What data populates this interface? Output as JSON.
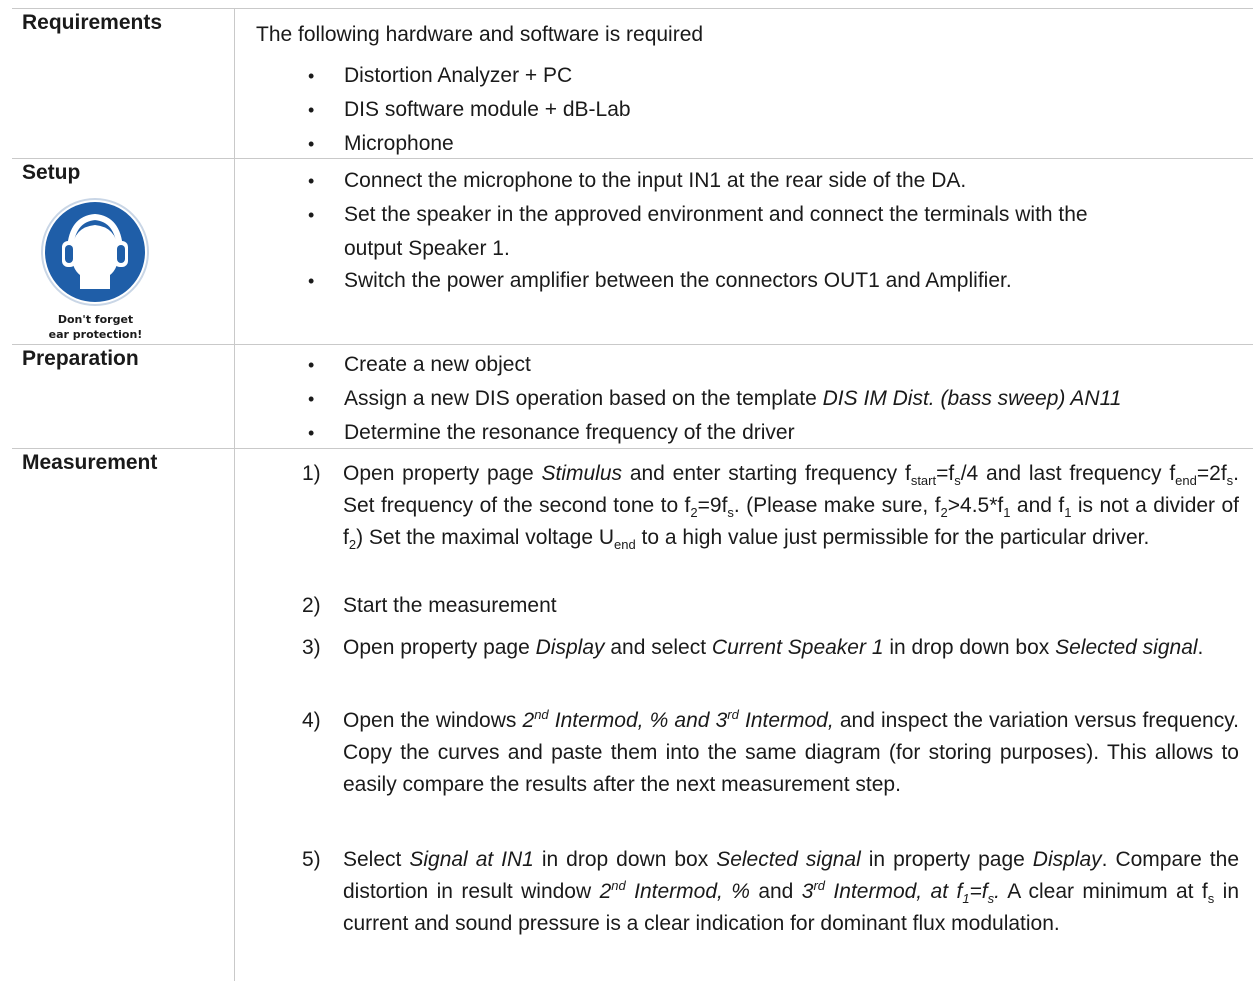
{
  "requirements": {
    "label": "Requirements",
    "intro": "The following hardware and software is required",
    "items": [
      "Distortion Analyzer + PC",
      "DIS software module + dB-Lab",
      "Microphone"
    ]
  },
  "setup": {
    "label": "Setup",
    "sign_caption_line1": "Don't forget",
    "sign_caption_line2": "ear protection!",
    "items": [
      "Connect the microphone to the input IN1 at the rear side of the DA.",
      "Set the speaker in the approved environment and connect the terminals with the",
      "output Speaker 1.",
      "Switch the power amplifier between the connectors OUT1 and Amplifier."
    ]
  },
  "preparation": {
    "label": "Preparation",
    "item1": "Create a new object",
    "item2_plain": "Assign a new DIS operation based on the template ",
    "item2_italic": "DIS IM Dist. (bass sweep) AN11",
    "item3": "Determine the resonance frequency of the driver"
  },
  "measurement": {
    "label": "Measurement",
    "numbers": [
      "1)",
      "2)",
      "3)",
      "4)",
      "5)"
    ],
    "s1": {
      "a": "Open property page ",
      "b": "Stimulus",
      "c": " and enter starting frequency f",
      "d": "start",
      "e": "=f",
      "f": "s",
      "g": "/4 and last frequency f",
      "h": "end",
      "i": "=2f",
      "j": "s",
      "k": ". Set frequency of the second tone to f",
      "l": "2",
      "m": "=9f",
      "n": "s",
      "o": ". (Please make sure, f",
      "p": "2",
      "q": ">4.5*f",
      "r": "1",
      "s": " and f",
      "t": "1",
      "u": " is not a divider of f",
      "v": "2",
      "w": ") Set the maximal voltage U",
      "x": "end",
      "y": " to a high value just permissible for the particular driver."
    },
    "s2": "Start the measurement",
    "s3": {
      "a": "Open property page ",
      "b": "Display",
      "c": " and select ",
      "d": "Current Speaker 1",
      "e": " in drop down box ",
      "f": "Selected signal",
      "g": "."
    },
    "s4": {
      "a": "Open the windows ",
      "b": "2",
      "c": "nd",
      "d": " Intermod, % and 3",
      "e": "rd",
      "f": " Intermod,",
      "g": " and inspect the variation versus frequency. Copy the curves and paste them into the same diagram (for storing purposes). This allows to easily compare the results after the next measurement step."
    },
    "s5": {
      "a": "Select ",
      "b": "Signal at IN1",
      "c": " in drop down box ",
      "d": "Selected signal",
      "e": " in property page ",
      "f": "Display",
      "g": ". Compare the distortion in result window ",
      "h": "2",
      "i": "nd",
      "j": " Intermod, %",
      "k": " and ",
      "l": "3",
      "m": "rd",
      "n": " Intermod, at f",
      "o": "1",
      "p": "=f",
      "q": "s",
      "r": ".",
      "s": " A clear minimum at f",
      "t": "s",
      "u": " in current and sound pressure is a clear indication for dominant flux modulation."
    }
  },
  "bullet": "•",
  "colors": {
    "sign_blue": "#1f5ea8",
    "rule": "#c9c9c9"
  }
}
